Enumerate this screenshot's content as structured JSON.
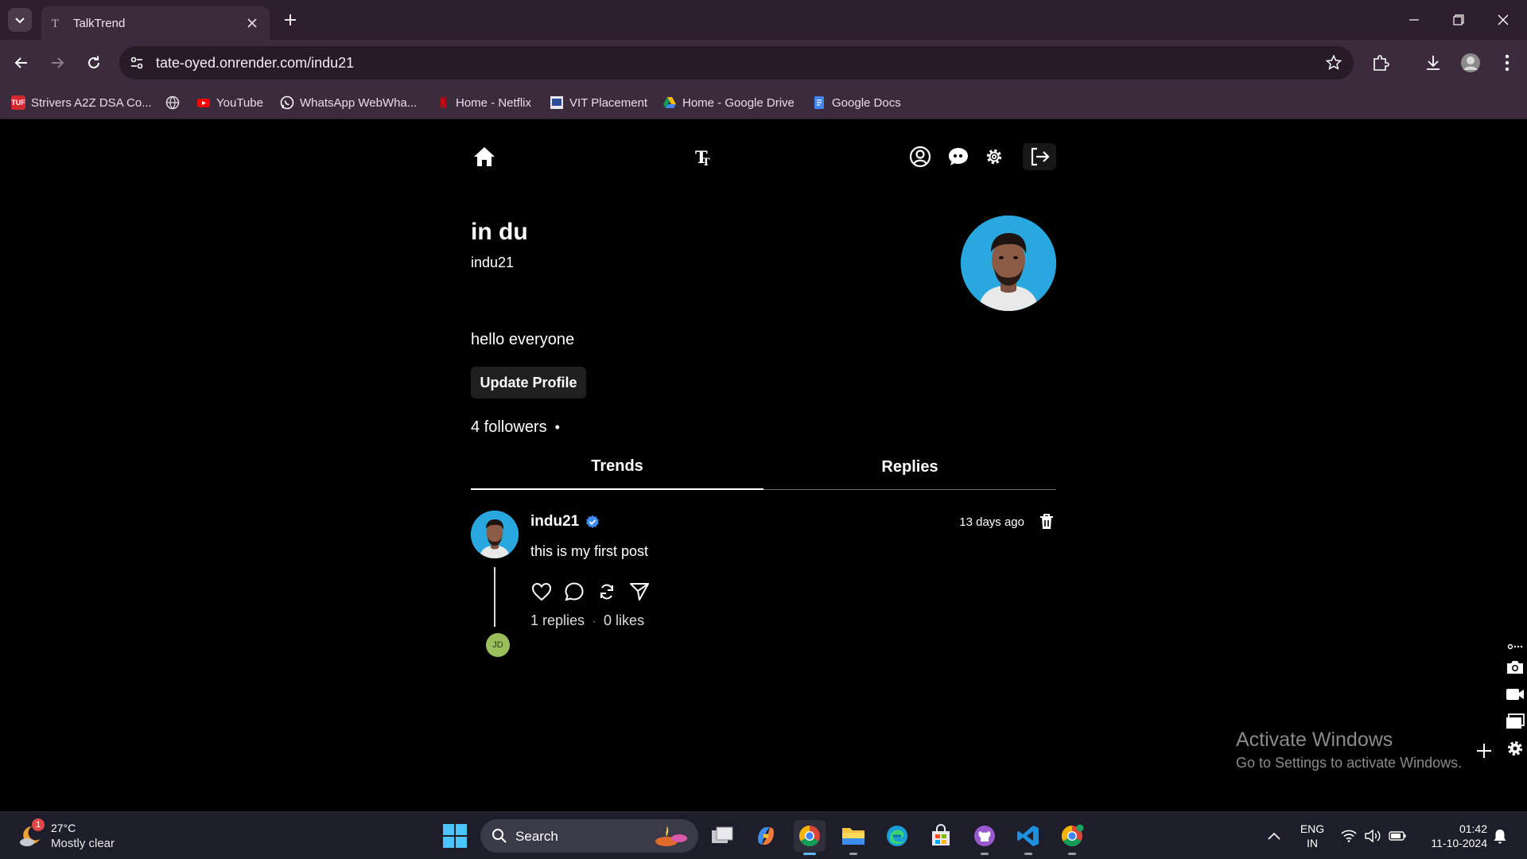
{
  "browser": {
    "tab_title": "TalkTrend",
    "url": "tate-oyed.onrender.com/indu21",
    "bookmarks": [
      {
        "label": "Strivers A2Z DSA Co...",
        "icon": "tuf-icon"
      },
      {
        "label": "",
        "icon": "globe-icon"
      },
      {
        "label": "YouTube",
        "icon": "youtube-icon"
      },
      {
        "label": "WhatsApp WebWha...",
        "icon": "whatsapp-icon"
      },
      {
        "label": "Home - Netflix",
        "icon": "netflix-icon"
      },
      {
        "label": "VIT Placement",
        "icon": "vit-icon"
      },
      {
        "label": "Home - Google Drive",
        "icon": "google-drive-icon"
      },
      {
        "label": "Google Docs",
        "icon": "google-docs-icon"
      }
    ],
    "bookmark_icon_text": {
      "tuf": "TUF"
    }
  },
  "app": {
    "header_icons": [
      "home-icon",
      "logo-icon",
      "profile-icon",
      "chat-icon",
      "settings-icon",
      "logout-icon"
    ]
  },
  "profile": {
    "name": "in du",
    "username": "indu21",
    "bio": "hello everyone",
    "update_button": "Update Profile",
    "followers": "4 followers",
    "followers_sep": "•"
  },
  "tabs": [
    {
      "label": "Trends",
      "active": true
    },
    {
      "label": "Replies",
      "active": false
    }
  ],
  "post": {
    "username": "indu21",
    "verified": true,
    "time": "13 days ago",
    "text": "this is my first post",
    "replies": "1 replies",
    "sep": "·",
    "likes": "0 likes",
    "reply_avatar_initials": "JD"
  },
  "watermark": {
    "title": "Activate Windows",
    "subtitle": "Go to Settings to activate Windows."
  },
  "taskbar": {
    "weather_temp": "27°C",
    "weather_desc": "Mostly clear",
    "weather_badge": "1",
    "search_label": "Search",
    "lang_line1": "ENG",
    "lang_line2": "IN",
    "time": "01:42",
    "date": "11-10-2024",
    "apps": [
      "task-view-icon",
      "copilot-icon",
      "chrome-icon",
      "file-explorer-icon",
      "edge-icon",
      "store-icon",
      "github-desktop-icon",
      "vscode-icon",
      "chrome-profile-icon"
    ]
  },
  "colors": {
    "page_bg": "#000000",
    "browser_frame": "#3c2b3c",
    "avatar_bg": "#29a8e0",
    "verified_blue": "#3d8bfd",
    "reply_avatar_bg": "#9abf5c"
  }
}
